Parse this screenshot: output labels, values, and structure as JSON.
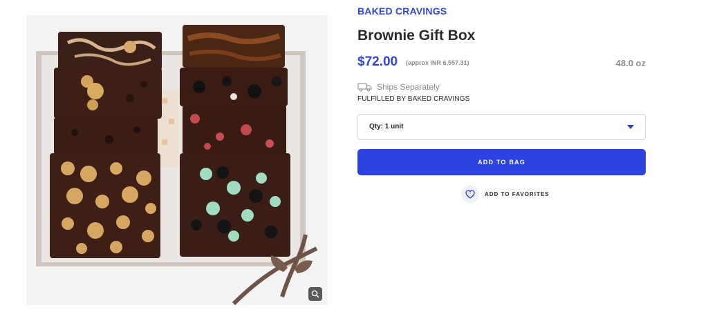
{
  "product": {
    "brand": "BAKED CRAVINGS",
    "title": "Brownie Gift Box",
    "price": "$72.00",
    "price_approx": "(approx INR 6,557.31)",
    "weight": "48.0 oz",
    "shipping_note": "Ships Separately",
    "fulfilled_by": "FULFILLED BY BAKED CRAVINGS",
    "quantity_select": "Qty: 1 unit",
    "add_to_bag_label": "ADD TO BAG",
    "add_to_favorites_label": "ADD TO FAVORITES"
  },
  "icons": {
    "shipping": "truck-icon",
    "dropdown": "caret-down-icon",
    "favorite": "heart-icon",
    "zoom": "zoom-icon"
  },
  "colors": {
    "accent": "#2c43e1",
    "brand_text": "#2f47e0",
    "muted_text": "#8c8c8c"
  }
}
